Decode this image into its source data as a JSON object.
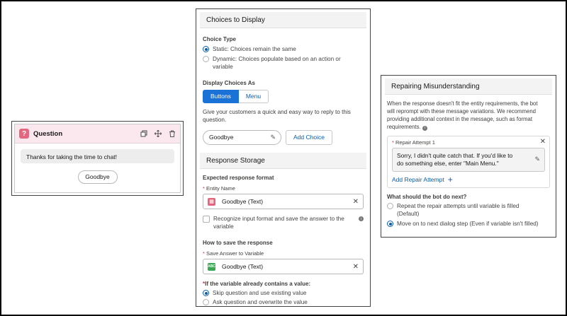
{
  "question_card": {
    "title": "Question",
    "icon": "question-icon",
    "message": "Thanks for taking the time to chat!",
    "choice_button": "Goodbye"
  },
  "choices": {
    "header": "Choices to Display",
    "choice_type_label": "Choice Type",
    "static_option": "Static: Choices remain the same",
    "dynamic_option_line1": "Dynamic: Choices populate based on an action or",
    "dynamic_option_line2": "variable",
    "display_as_label": "Display Choices As",
    "buttons_label": "Buttons",
    "menu_label": "Menu",
    "helper_line1": "Give your customers a quick and easy way to reply to this",
    "helper_line2": "question.",
    "choice_pill": "Goodbye",
    "add_choice": "Add Choice"
  },
  "response_storage": {
    "header": "Response Storage",
    "expected_format_label": "Expected response format",
    "entity_name_label": "Entity Name",
    "entity_value": "Goodbye (Text)",
    "recognize_line1": "Recognize input format and save the answer to the",
    "recognize_line2": "variable",
    "how_to_save_label": "How to save the response",
    "save_answer_label": "Save Answer to Variable",
    "variable_value": "Goodbye (Text)",
    "variable_icon_text": "ABC",
    "if_contains_label": "If the variable already contains a value:",
    "skip_option": "Skip question and use existing value",
    "ask_option": "Ask question and overwrite the value"
  },
  "repair": {
    "header": "Repairing Misunderstanding",
    "desc_line1": "When the response doesn't fit the entity requirements, the bot",
    "desc_line2": "will reprompt with these message variations. We recommend",
    "desc_line3": "providing additional context in the message, such as format",
    "desc_line4": "requirements.",
    "attempt_label": "Repair Attempt 1",
    "attempt_text_line1": "Sorry, I didn't quite catch that. If you'd like to",
    "attempt_text_line2": "do something else, enter \"Main Menu.\"",
    "add_attempt": "Add Repair Attempt",
    "next_label": "What should the bot do next?",
    "repeat_line1": "Repeat the repair attempts until variable is filled",
    "repeat_line2": "(Default)",
    "move_on": "Move on to next dialog step (Even if variable isn't filled)"
  },
  "colors": {
    "accent_blue": "#1b72d6",
    "question_pink": "#e3677f",
    "variable_green": "#3ba755"
  }
}
